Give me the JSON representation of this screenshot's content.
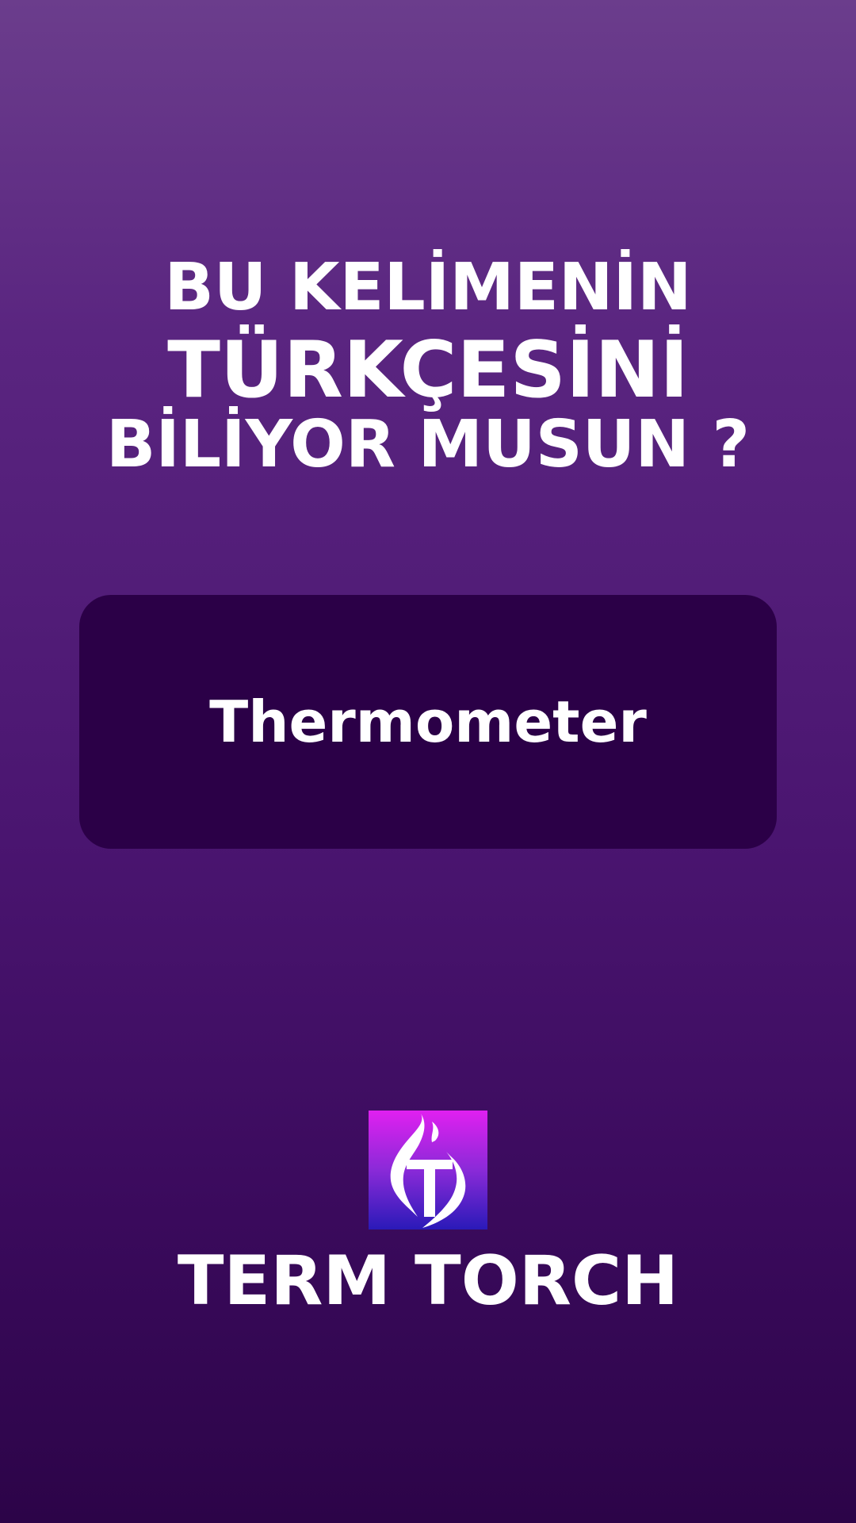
{
  "headline": {
    "line1": "BU KELİMENİN",
    "line2": "TÜRKÇESİNİ",
    "line3": "BİLİYOR MUSUN ?"
  },
  "card": {
    "word": "Thermometer"
  },
  "brand": {
    "logo_icon": "torch-flame-t-logo-icon",
    "name": "TERM TORCH"
  },
  "colors": {
    "background_top": "#6b3d8c",
    "background_bottom": "#2c0448",
    "card_background": "#2b0047",
    "logo_gradient_top": "#e020f0",
    "logo_gradient_bottom": "#2a1ab8",
    "text": "#ffffff"
  }
}
